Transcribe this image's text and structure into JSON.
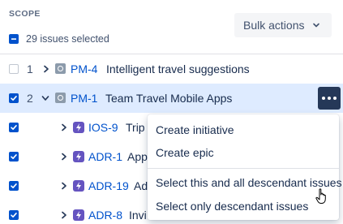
{
  "header": {
    "scope_label": "SCOPE",
    "bulk_actions_label": "Bulk actions",
    "selection_text": "29 issues selected"
  },
  "rows": [
    {
      "num": "1",
      "key": "PM-4",
      "summary": "Intelligent travel suggestions",
      "checked": false,
      "expanded": false,
      "type": "story"
    },
    {
      "num": "2",
      "key": "PM-1",
      "summary": "Team Travel Mobile Apps",
      "checked": true,
      "expanded": true,
      "type": "story"
    },
    {
      "key": "IOS-9",
      "summary": "Trip",
      "checked": true,
      "type": "epic"
    },
    {
      "key": "ADR-1",
      "summary": "App",
      "checked": true,
      "type": "epic"
    },
    {
      "key": "ADR-19",
      "summary": "Ad",
      "checked": true,
      "type": "epic"
    },
    {
      "key": "ADR-8",
      "summary": "Invi",
      "checked": true,
      "type": "epic"
    }
  ],
  "menu": {
    "items": [
      "Create initiative",
      "Create epic",
      "Select this and all descendant issues",
      "Select only descendant issues"
    ]
  },
  "colors": {
    "accent": "#0052cc",
    "row_highlight": "#deebff",
    "more_button": "#253858",
    "epic_icon": "#6554c0"
  }
}
